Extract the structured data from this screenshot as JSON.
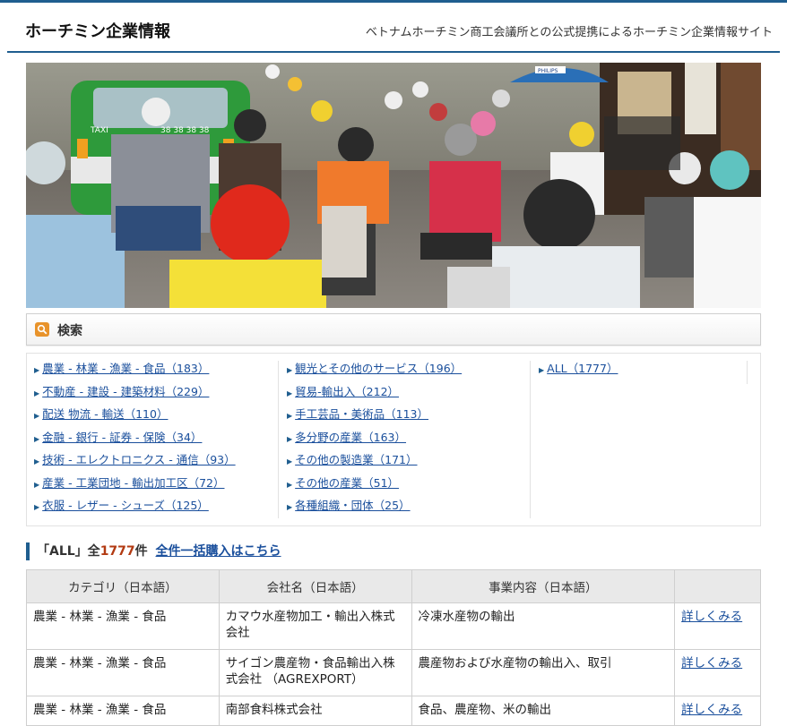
{
  "header": {
    "site_title": "ホーチミン企業情報",
    "tagline": "ベトナムホーチミン商工会議所との公式提携によるホーチミン企業情報サイト"
  },
  "banner": {
    "taxi_label": "TAXI",
    "taxi_number": "38 38 38 38",
    "store_sign": "PHILIPS"
  },
  "search": {
    "label": "検索"
  },
  "categories": {
    "col1": [
      "農業 - 林業 - 漁業 - 食品（183）",
      "不動産 - 建設 - 建築材料（229）",
      "配送 物流 - 輸送（110）",
      "金融 - 銀行 - 証券 - 保険（34）",
      "技術 - エレクトロニクス - 通信（93）",
      "産業 - 工業団地 - 輸出加工区（72）",
      "衣服 - レザー - シューズ（125）"
    ],
    "col2": [
      "観光とその他のサービス（196）",
      "貿易-輸出入（212）",
      "手工芸品・美術品（113）",
      "多分野の産業（163）",
      "その他の製造業（171）",
      "その他の産業（51）",
      "各種組織・団体（25）"
    ],
    "col3": [
      "ALL（1777）"
    ]
  },
  "summary": {
    "prefix": "「ALL」全",
    "count": "1777",
    "suffix": "件",
    "bulk_link": "全件一括購入はこちら"
  },
  "table": {
    "headers": [
      "カテゴリ（日本語）",
      "会社名（日本語）",
      "事業内容（日本語）",
      ""
    ],
    "rows": [
      [
        "農業 - 林業 - 漁業 - 食品",
        "カマウ水産物加工・輸出入株式会社",
        "冷凍水産物の輸出",
        "詳しくみる"
      ],
      [
        "農業 - 林業 - 漁業 - 食品",
        "サイゴン農産物・食品輸出入株式会社 （AGREXPORT）",
        "農産物および水産物の輸出入、取引",
        "詳しくみる"
      ],
      [
        "農業 - 林業 - 漁業 - 食品",
        "南部食料株式会社",
        "食品、農産物、米の輸出",
        "詳しくみる"
      ]
    ]
  }
}
